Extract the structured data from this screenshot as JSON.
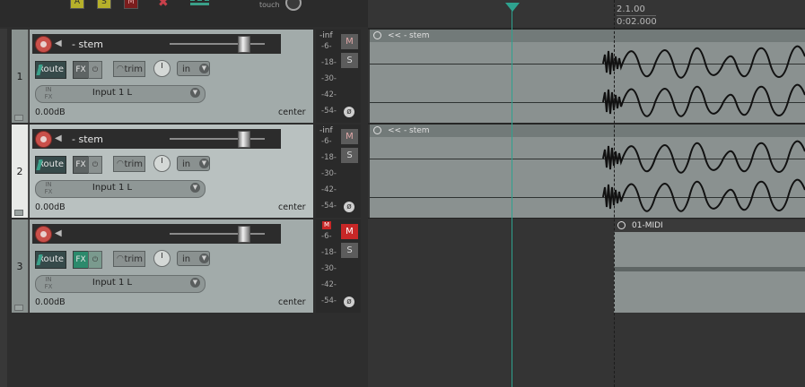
{
  "topbar": {
    "a_label": "A",
    "s_label": "S",
    "m_label": "M",
    "x_label": "✖",
    "touch_label": "touch"
  },
  "ruler": {
    "measure": "2.1.00",
    "time": "0:02.000"
  },
  "tracks": [
    {
      "number": "1",
      "name": "- stem",
      "route": "Route",
      "fx": "FX",
      "trim": "trim",
      "in": "in",
      "input": "Input 1 L",
      "infx": "IN FX",
      "volume": "0.00dB",
      "pan": "center",
      "meter_top": "-inf",
      "selected": false,
      "fx_on": false,
      "muted": false
    },
    {
      "number": "2",
      "name": "- stem",
      "route": "Route",
      "fx": "FX",
      "trim": "trim",
      "in": "in",
      "input": "Input 1 L",
      "infx": "IN FX",
      "volume": "0.00dB",
      "pan": "center",
      "meter_top": "-inf",
      "selected": true,
      "fx_on": false,
      "muted": false
    },
    {
      "number": "3",
      "name": "",
      "route": "Route",
      "fx": "FX",
      "trim": "trim",
      "in": "in",
      "input": "Input 1 L",
      "infx": "IN FX",
      "volume": "0.00dB",
      "pan": "center",
      "meter_top": "",
      "selected": false,
      "fx_on": true,
      "muted": true
    }
  ],
  "meter_ticks": [
    "-6-",
    "-18-",
    "-30-",
    "-42-",
    "-54-"
  ],
  "buttons": {
    "mute": "M",
    "solo": "S",
    "phase": "ø"
  },
  "items": [
    {
      "name": "<< - stem"
    },
    {
      "name": "<< - stem"
    },
    {
      "name": "01-MIDI"
    }
  ],
  "colors": {
    "cursor": "#2ea28f",
    "record": "#c9504a",
    "mute_on": "#c82727",
    "fx_on": "#2c8a6c"
  }
}
